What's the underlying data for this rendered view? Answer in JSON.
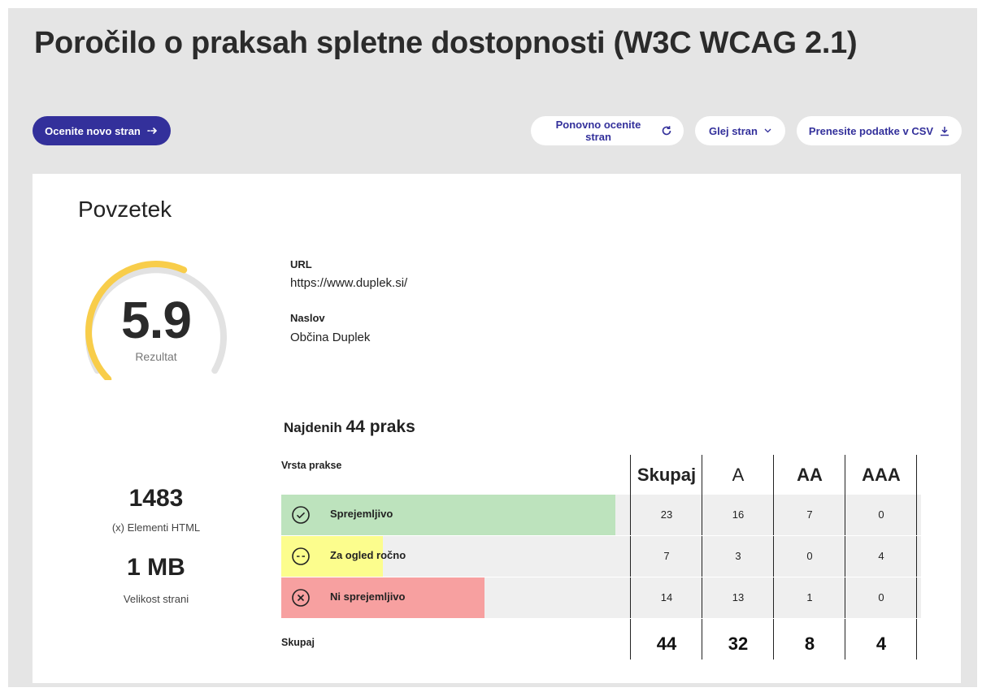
{
  "title": "Poročilo o praksah spletne dostopnosti (W3C WCAG 2.1)",
  "actions": {
    "evaluate_new": "Ocenite novo stran",
    "reevaluate": "Ponovno ocenite stran",
    "view_page": "Glej stran",
    "download_csv": "Prenesite podatke v CSV"
  },
  "summary": {
    "heading": "Povzetek",
    "score": "5.9",
    "score_value": 5.9,
    "score_max": 10,
    "score_label": "Rezultat",
    "url_label": "URL",
    "url": "https://www.duplek.si/",
    "title_label": "Naslov",
    "page_title": "Občina Duplek",
    "elements_count": "1483",
    "elements_label": "(x) Elementi HTML",
    "page_size": "1 MB",
    "page_size_label": "Velikost strani"
  },
  "practices": {
    "found_prefix": "Najdenih",
    "found_count": "44 praks",
    "type_header": "Vrsta prakse",
    "columns": [
      "Skupaj",
      "A",
      "AA",
      "AAA"
    ],
    "rows": [
      {
        "label": "Sprejemljivo",
        "values": [
          "23",
          "16",
          "7",
          "0"
        ],
        "color": "#bde3bd",
        "icon": "check-circle-icon",
        "fraction": 0.5227
      },
      {
        "label": "Za ogled ročno",
        "values": [
          "7",
          "3",
          "0",
          "4"
        ],
        "color": "#fcfd8d",
        "icon": "minus-circle-icon",
        "fraction": 0.1591
      },
      {
        "label": "Ni sprejemljivo",
        "values": [
          "14",
          "13",
          "1",
          "0"
        ],
        "color": "#f7a0a0",
        "icon": "x-circle-icon",
        "fraction": 0.3182
      }
    ],
    "total_label": "Skupaj",
    "totals": [
      "44",
      "32",
      "8",
      "4"
    ]
  },
  "colors": {
    "primary": "#33309b",
    "gauge_fill": "#f8cd4a",
    "gauge_track": "#e2e2e2"
  }
}
